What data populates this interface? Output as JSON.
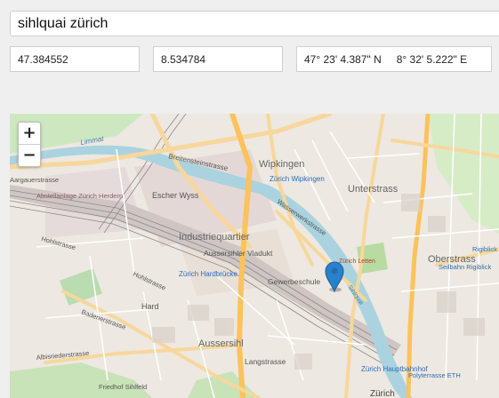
{
  "search": {
    "value": "sihlquai zürich"
  },
  "coordinates": {
    "latitude": "47.384552",
    "longitude": "8.534784",
    "dms_lat": "47° 23' 4.387\" N",
    "dms_lng": "8° 32' 5.222\" E"
  },
  "map": {
    "zoom_in": "+",
    "zoom_out": "−",
    "labels": [
      "Breitensteinstrasse",
      "Wipkingen",
      "Unterstrass",
      "Zürich Wipkingen",
      "Escher Wyss",
      "Abstellanlage Zürich Herdern",
      "Aargauerstrasse",
      "Industriequartier",
      "Aussersihler Viadukt",
      "Gewerbeschule",
      "Zürich Hardbrücke",
      "Hohlstrasse",
      "Hard",
      "Aussersihl",
      "Langstrasse",
      "Oberstrass",
      "Seilbahn Rigiblick",
      "Rigiblick",
      "Zürich Letten",
      "Zürich Hauptbahnhof",
      "Polyterrasse ETH",
      "Limmat",
      "Sihlquai",
      "Wasserwerkstrasse",
      "Badenerstrasse",
      "Albisriederstrasse",
      "Friedhof Sihlfeld",
      "Zürich",
      "Hohlstrasse"
    ],
    "marker_color": "#2a81cb"
  }
}
